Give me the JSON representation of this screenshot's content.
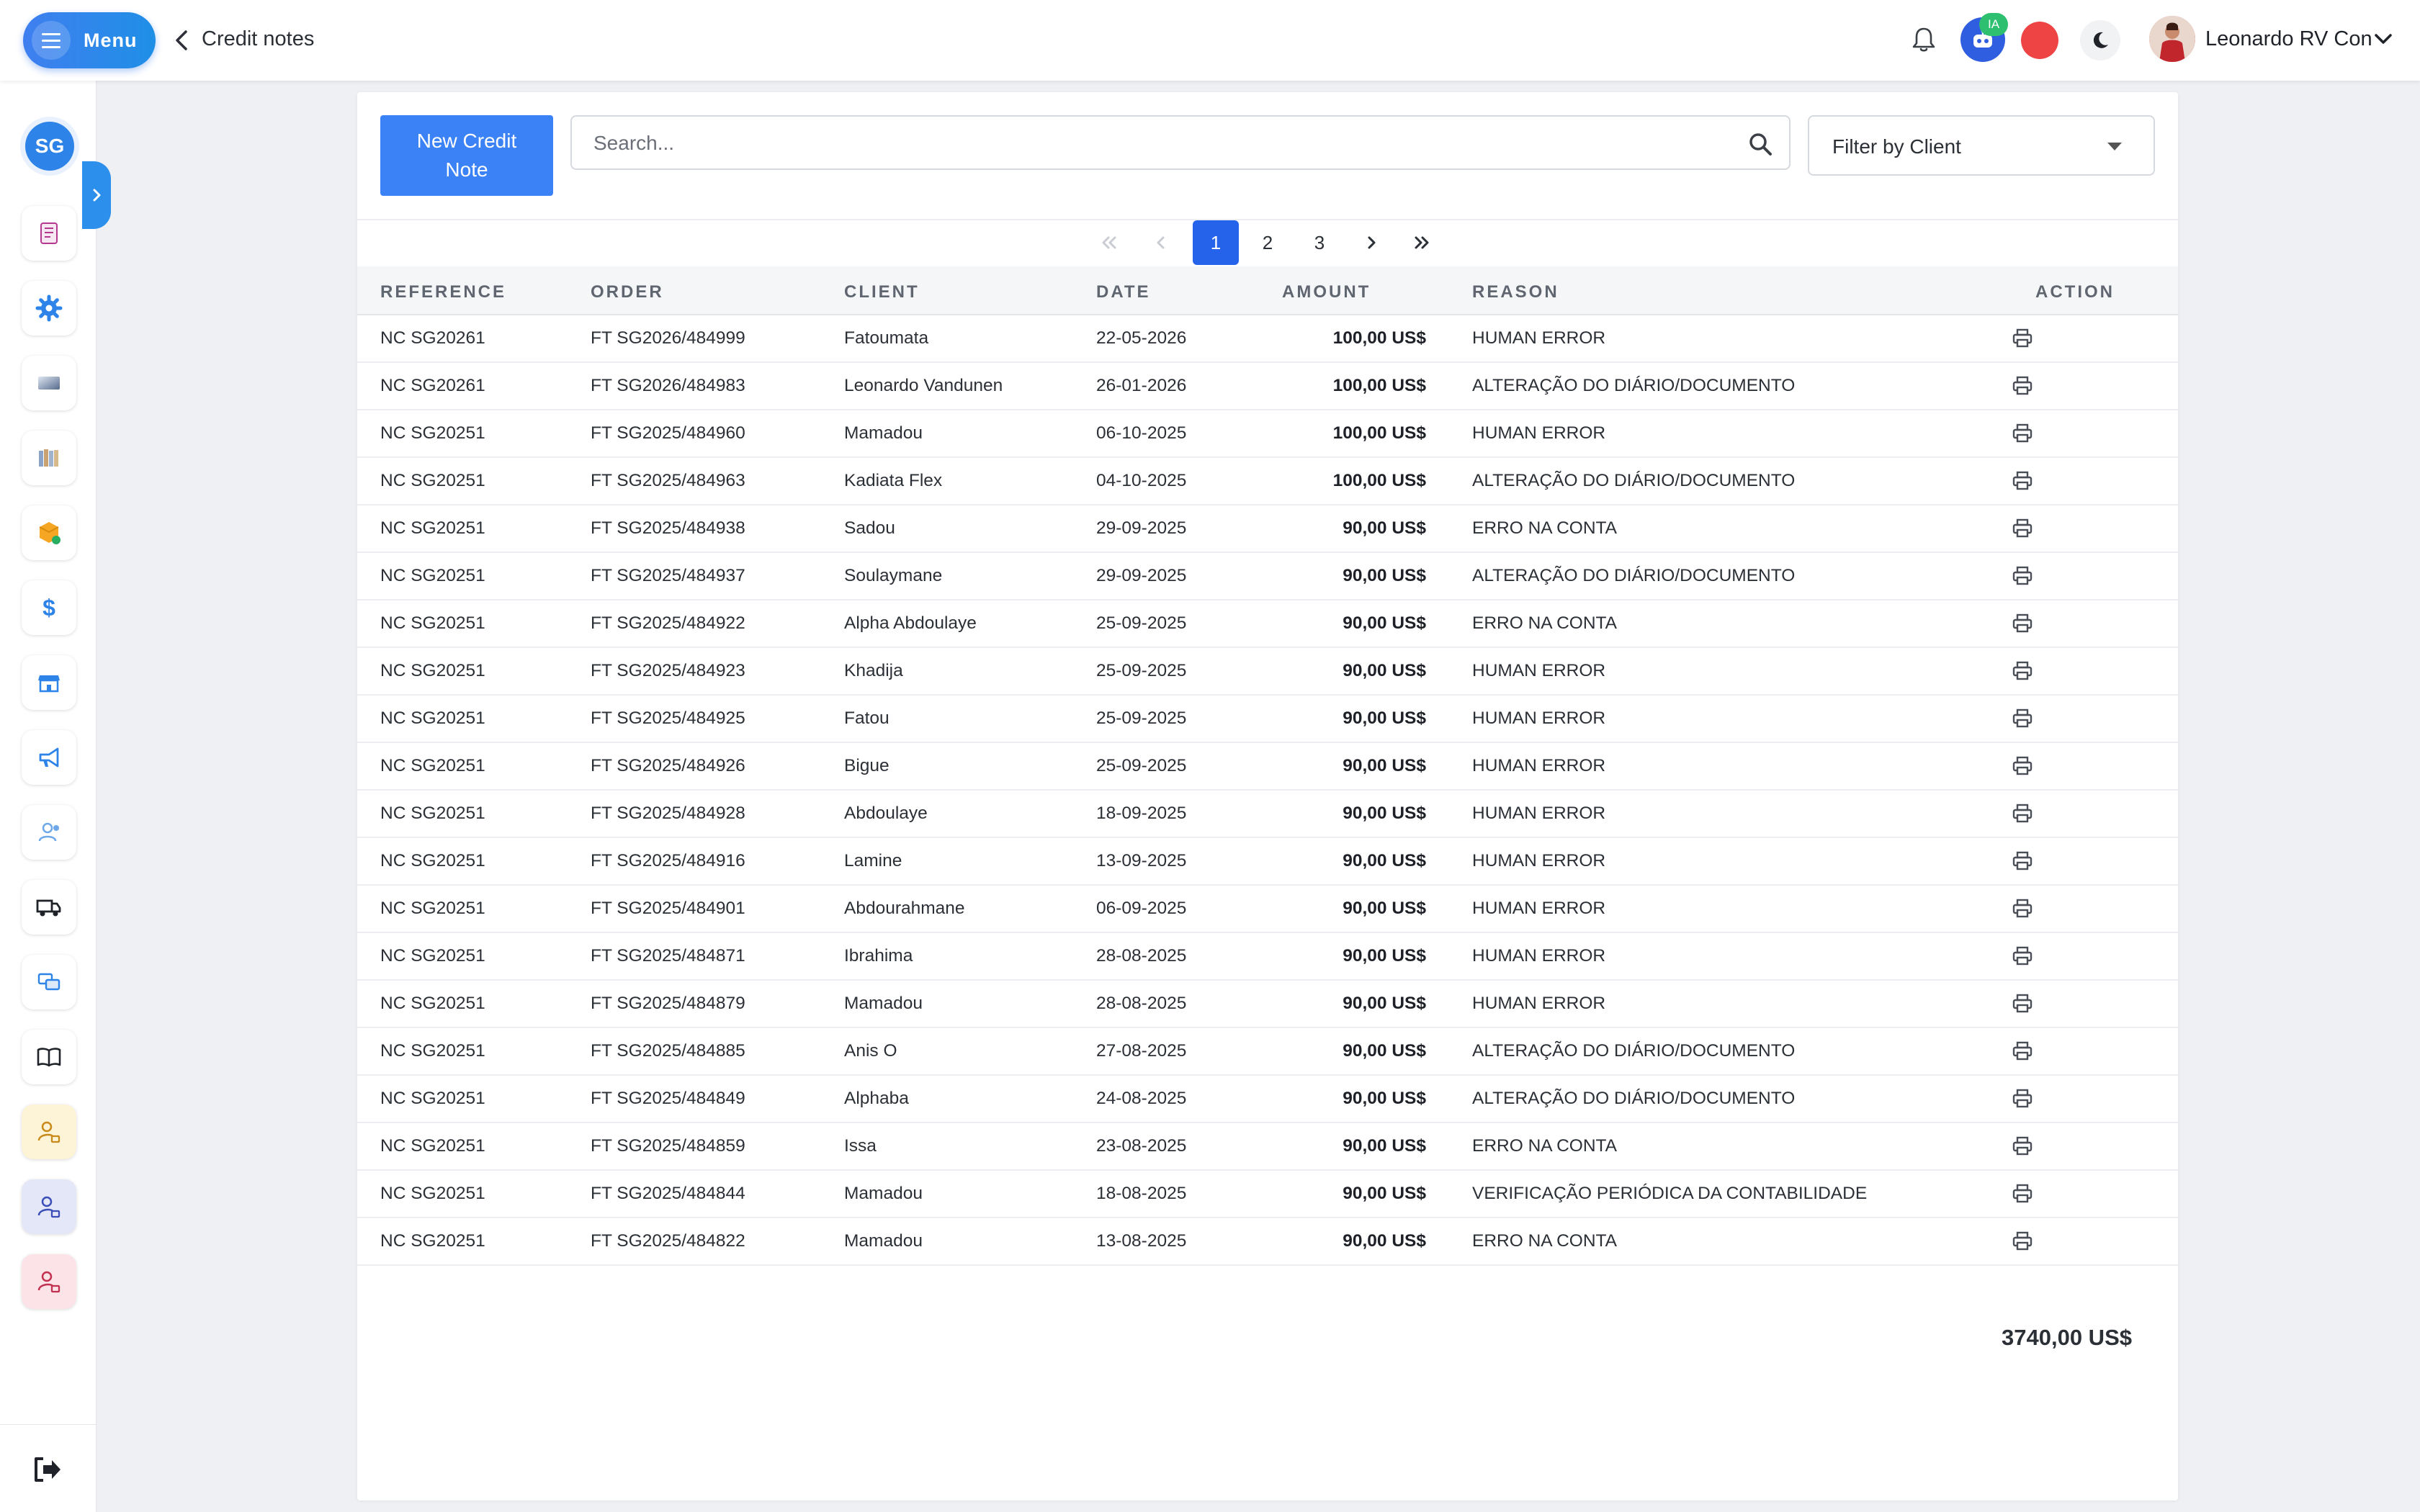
{
  "topbar": {
    "menu_label": "Menu",
    "page_title": "Credit notes",
    "ia_badge": "IA",
    "user_name": "Leonardo RV Con"
  },
  "sidebar": {
    "company_badge": "SG",
    "icons": [
      "scroll-icon",
      "gear-icon",
      "card-icon",
      "books-icon",
      "box-icon",
      "dollar-icon",
      "store-icon",
      "megaphone-icon",
      "person-cog-icon",
      "truck-icon",
      "chat-icon",
      "book-open-icon",
      "user-lock-icon-yellow",
      "user-lock-icon-blue",
      "user-lock-icon-red",
      "logout-icon"
    ]
  },
  "toolbar": {
    "new_button": "New Credit Note",
    "search_placeholder": "Search...",
    "filter_label": "Filter by Client"
  },
  "pagination": {
    "pages": [
      "1",
      "2",
      "3"
    ],
    "current": "1"
  },
  "table": {
    "headers": {
      "reference": "REFERENCE",
      "order": "ORDER",
      "client": "CLIENT",
      "date": "DATE",
      "amount": "AMOUNT",
      "reason": "REASON",
      "action": "ACTION"
    },
    "rows": [
      {
        "reference": "NC SG20261",
        "order": "FT SG2026/484999",
        "client": "Fatoumata",
        "date": "22-05-2026",
        "amount": "100,00 US$",
        "reason": "HUMAN ERROR"
      },
      {
        "reference": "NC SG20261",
        "order": "FT SG2026/484983",
        "client": "Leonardo Vandunen",
        "date": "26-01-2026",
        "amount": "100,00 US$",
        "reason": "ALTERAÇÃO DO DIÁRIO/DOCUMENTO"
      },
      {
        "reference": "NC SG20251",
        "order": "FT SG2025/484960",
        "client": "Mamadou",
        "date": "06-10-2025",
        "amount": "100,00 US$",
        "reason": "HUMAN ERROR"
      },
      {
        "reference": "NC SG20251",
        "order": "FT SG2025/484963",
        "client": "Kadiata Flex",
        "date": "04-10-2025",
        "amount": "100,00 US$",
        "reason": "ALTERAÇÃO DO DIÁRIO/DOCUMENTO"
      },
      {
        "reference": "NC SG20251",
        "order": "FT SG2025/484938",
        "client": "Sadou",
        "date": "29-09-2025",
        "amount": "90,00 US$",
        "reason": "ERRO NA CONTA"
      },
      {
        "reference": "NC SG20251",
        "order": "FT SG2025/484937",
        "client": "Soulaymane",
        "date": "29-09-2025",
        "amount": "90,00 US$",
        "reason": "ALTERAÇÃO DO DIÁRIO/DOCUMENTO"
      },
      {
        "reference": "NC SG20251",
        "order": "FT SG2025/484922",
        "client": "Alpha Abdoulaye",
        "date": "25-09-2025",
        "amount": "90,00 US$",
        "reason": "ERRO NA CONTA"
      },
      {
        "reference": "NC SG20251",
        "order": "FT SG2025/484923",
        "client": "Khadija",
        "date": "25-09-2025",
        "amount": "90,00 US$",
        "reason": "HUMAN ERROR"
      },
      {
        "reference": "NC SG20251",
        "order": "FT SG2025/484925",
        "client": "Fatou",
        "date": "25-09-2025",
        "amount": "90,00 US$",
        "reason": "HUMAN ERROR"
      },
      {
        "reference": "NC SG20251",
        "order": "FT SG2025/484926",
        "client": "Bigue",
        "date": "25-09-2025",
        "amount": "90,00 US$",
        "reason": "HUMAN ERROR"
      },
      {
        "reference": "NC SG20251",
        "order": "FT SG2025/484928",
        "client": "Abdoulaye",
        "date": "18-09-2025",
        "amount": "90,00 US$",
        "reason": "HUMAN ERROR"
      },
      {
        "reference": "NC SG20251",
        "order": "FT SG2025/484916",
        "client": "Lamine",
        "date": "13-09-2025",
        "amount": "90,00 US$",
        "reason": "HUMAN ERROR"
      },
      {
        "reference": "NC SG20251",
        "order": "FT SG2025/484901",
        "client": "Abdourahmane",
        "date": "06-09-2025",
        "amount": "90,00 US$",
        "reason": "HUMAN ERROR"
      },
      {
        "reference": "NC SG20251",
        "order": "FT SG2025/484871",
        "client": "Ibrahima",
        "date": "28-08-2025",
        "amount": "90,00 US$",
        "reason": "HUMAN ERROR"
      },
      {
        "reference": "NC SG20251",
        "order": "FT SG2025/484879",
        "client": "Mamadou",
        "date": "28-08-2025",
        "amount": "90,00 US$",
        "reason": "HUMAN ERROR"
      },
      {
        "reference": "NC SG20251",
        "order": "FT SG2025/484885",
        "client": "Anis O",
        "date": "27-08-2025",
        "amount": "90,00 US$",
        "reason": "ALTERAÇÃO DO DIÁRIO/DOCUMENTO"
      },
      {
        "reference": "NC SG20251",
        "order": "FT SG2025/484849",
        "client": "Alphaba",
        "date": "24-08-2025",
        "amount": "90,00 US$",
        "reason": "ALTERAÇÃO DO DIÁRIO/DOCUMENTO"
      },
      {
        "reference": "NC SG20251",
        "order": "FT SG2025/484859",
        "client": "Issa",
        "date": "23-08-2025",
        "amount": "90,00 US$",
        "reason": "ERRO NA CONTA"
      },
      {
        "reference": "NC SG20251",
        "order": "FT SG2025/484844",
        "client": "Mamadou",
        "date": "18-08-2025",
        "amount": "90,00 US$",
        "reason": "VERIFICAÇÃO PERIÓDICA DA CONTABILIDADE"
      },
      {
        "reference": "NC SG20251",
        "order": "FT SG2025/484822",
        "client": "Mamadou",
        "date": "13-08-2025",
        "amount": "90,00 US$",
        "reason": "ERRO NA CONTA"
      }
    ]
  },
  "total": "3740,00 US$",
  "colors": {
    "primary": "#3b82f6",
    "active_page": "#2563eb",
    "sidebar_tab": "#2d8fec",
    "alert_red": "#ef4444",
    "ia_green": "#2fbf71"
  }
}
